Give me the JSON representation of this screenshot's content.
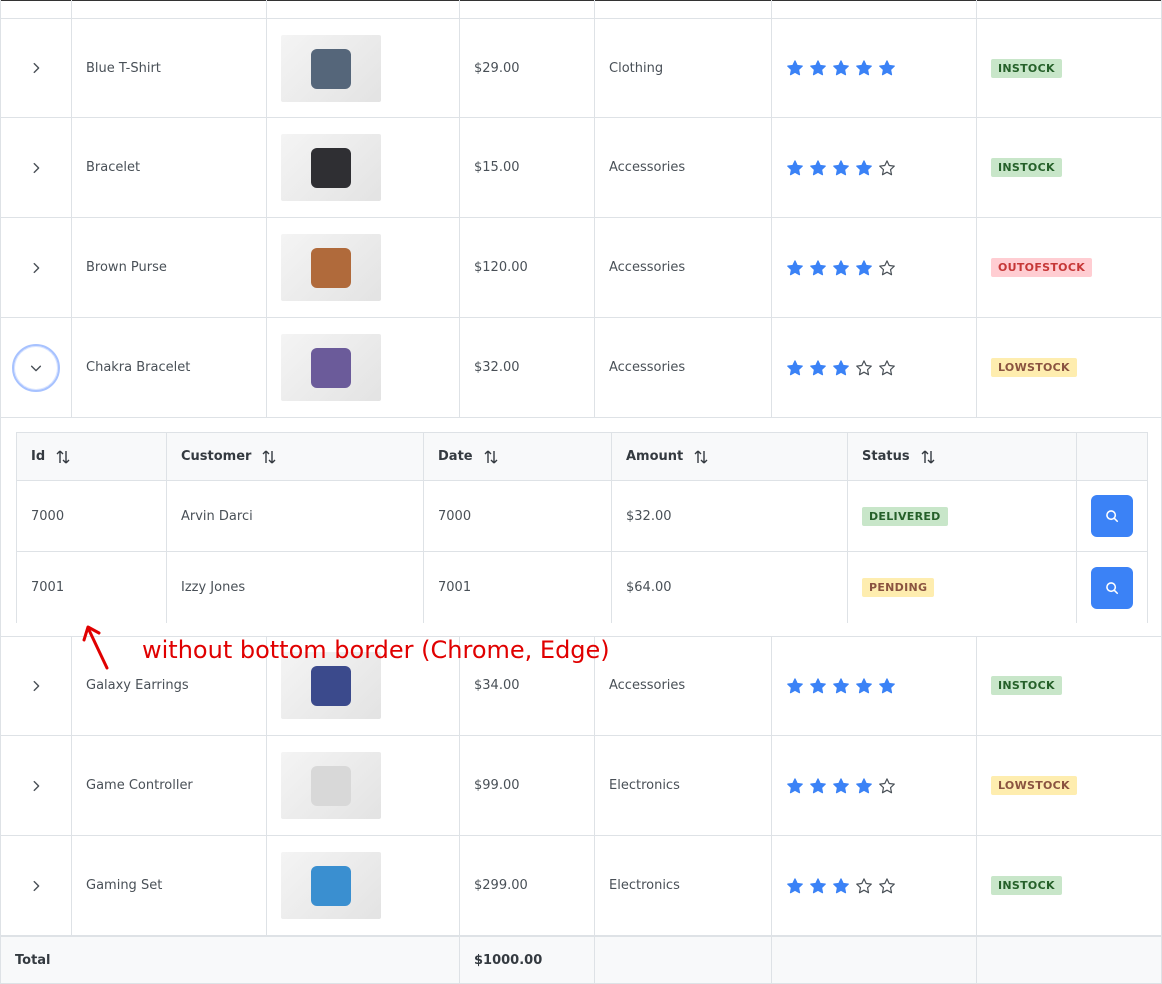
{
  "products": [
    {
      "name": "Blue T-Shirt",
      "price": "$29.00",
      "category": "Clothing",
      "rating": 5,
      "status": "INSTOCK",
      "status_kind": "instock",
      "thumb_color": "#55667a",
      "expanded": false
    },
    {
      "name": "Bracelet",
      "price": "$15.00",
      "category": "Accessories",
      "rating": 4,
      "status": "INSTOCK",
      "status_kind": "instock",
      "thumb_color": "#2f2f33",
      "expanded": false
    },
    {
      "name": "Brown Purse",
      "price": "$120.00",
      "category": "Accessories",
      "rating": 4,
      "status": "OUTOFSTOCK",
      "status_kind": "out",
      "thumb_color": "#b06a3b",
      "expanded": false
    },
    {
      "name": "Chakra Bracelet",
      "price": "$32.00",
      "category": "Accessories",
      "rating": 3,
      "status": "LOWSTOCK",
      "status_kind": "low",
      "thumb_color": "#6b5b9a",
      "expanded": true
    },
    {
      "name": "Galaxy Earrings",
      "price": "$34.00",
      "category": "Accessories",
      "rating": 5,
      "status": "INSTOCK",
      "status_kind": "instock",
      "thumb_color": "#3b4a8c",
      "expanded": false
    },
    {
      "name": "Game Controller",
      "price": "$99.00",
      "category": "Electronics",
      "rating": 4,
      "status": "LOWSTOCK",
      "status_kind": "low",
      "thumb_color": "#d8d8d8",
      "expanded": false
    },
    {
      "name": "Gaming Set",
      "price": "$299.00",
      "category": "Electronics",
      "rating": 3,
      "status": "INSTOCK",
      "status_kind": "instock",
      "thumb_color": "#3a8fd0",
      "expanded": false
    }
  ],
  "orders_table": {
    "headers": [
      "Id",
      "Customer",
      "Date",
      "Amount",
      "Status"
    ],
    "rows": [
      {
        "id": "7000",
        "customer": "Arvin Darci",
        "date": "7000",
        "amount": "$32.00",
        "status": "DELIVERED",
        "status_kind": "delivered"
      },
      {
        "id": "7001",
        "customer": "Izzy Jones",
        "date": "7001",
        "amount": "$64.00",
        "status": "PENDING",
        "status_kind": "pending"
      }
    ]
  },
  "footer": {
    "label": "Total",
    "total": "$1000.00"
  },
  "annotation": {
    "text": "without bottom border (Chrome, Edge)",
    "color": "#e00000"
  },
  "colors": {
    "accent": "#3b82f6",
    "star_filled": "#3b82f6",
    "star_empty": "#495057"
  }
}
